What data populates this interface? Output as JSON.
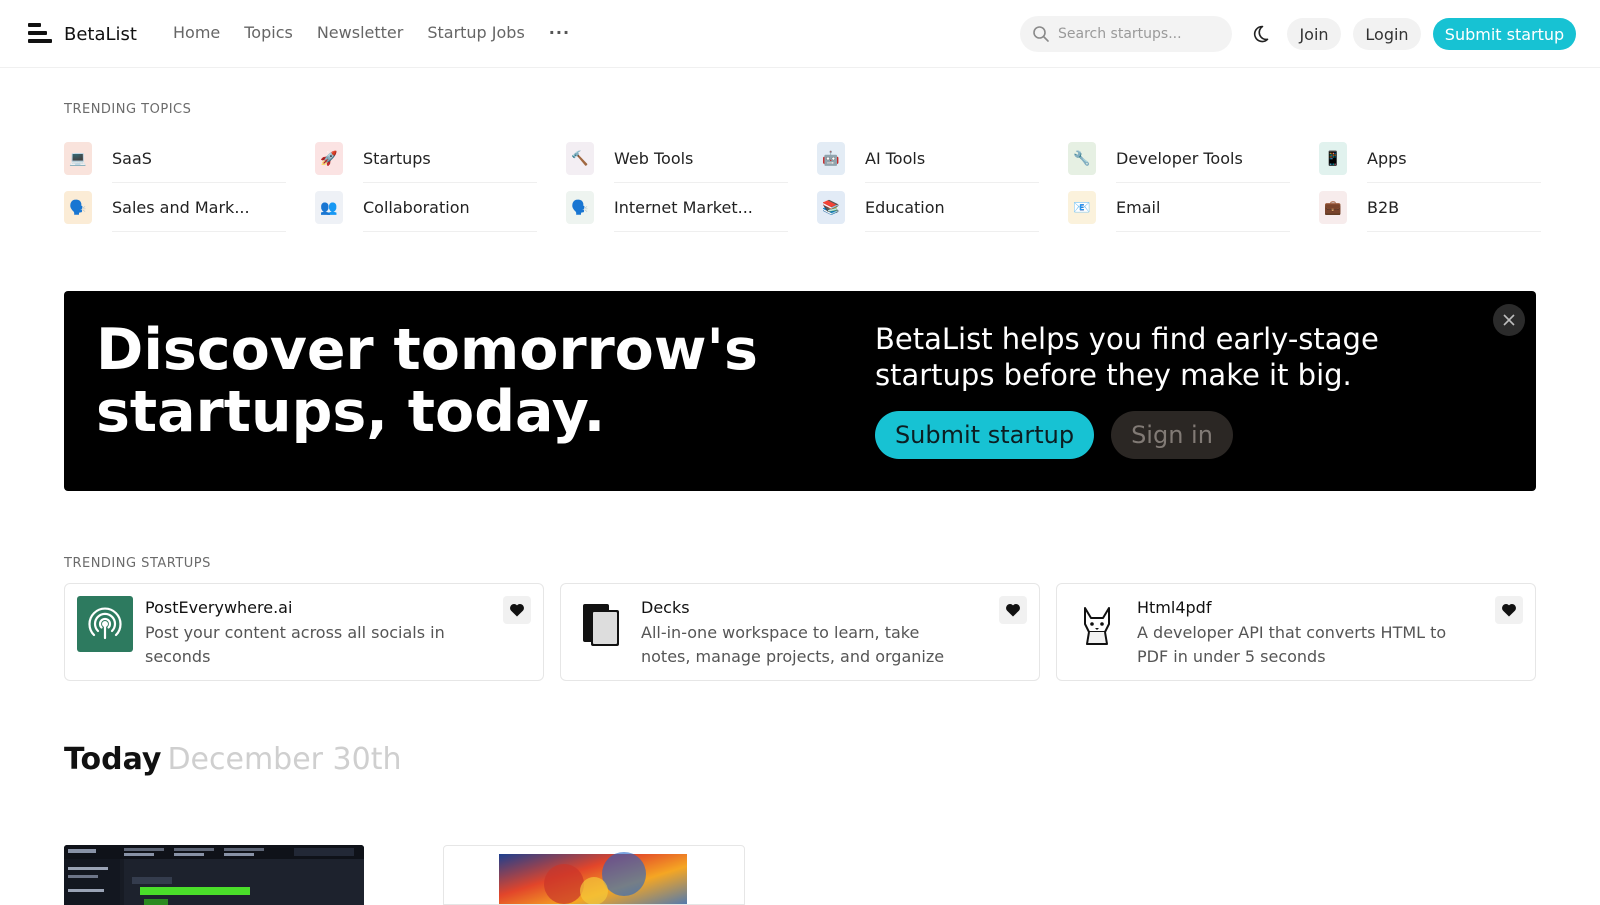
{
  "header": {
    "brand": "BetaList",
    "nav": [
      "Home",
      "Topics",
      "Newsletter",
      "Startup Jobs",
      "···"
    ],
    "search_placeholder": "Search startups...",
    "join_label": "Join",
    "login_label": "Login",
    "submit_label": "Submit startup"
  },
  "trending_topics": {
    "label": "TRENDING TOPICS",
    "items": [
      {
        "label": "SaaS",
        "icon": "laptop-icon",
        "emoji": "💻",
        "bg": "#f9e3dc"
      },
      {
        "label": "Startups",
        "icon": "rocket-icon",
        "emoji": "🚀",
        "bg": "#fbe3e3"
      },
      {
        "label": "Web Tools",
        "icon": "hammer-icon",
        "emoji": "🔨",
        "bg": "#f3eef3"
      },
      {
        "label": "AI Tools",
        "icon": "robot-icon",
        "emoji": "🤖",
        "bg": "#e3ecf5"
      },
      {
        "label": "Developer Tools",
        "icon": "wrench-icon",
        "emoji": "🔧",
        "bg": "#e6f0e3"
      },
      {
        "label": "Apps",
        "icon": "phone-icon",
        "emoji": "📱",
        "bg": "#e1f2ee"
      },
      {
        "label": "Sales and Mark...",
        "icon": "speaking-head-icon",
        "emoji": "🗣️",
        "bg": "#fbecd6"
      },
      {
        "label": "Collaboration",
        "icon": "people-icon",
        "emoji": "👥",
        "bg": "#eef1f6"
      },
      {
        "label": "Internet Market...",
        "icon": "speaking-head-icon",
        "emoji": "🗣️",
        "bg": "#eef4f0"
      },
      {
        "label": "Education",
        "icon": "books-icon",
        "emoji": "📚",
        "bg": "#e2ebf6"
      },
      {
        "label": "Email",
        "icon": "envelope-icon",
        "emoji": "📧",
        "bg": "#fbf2dc"
      },
      {
        "label": "B2B",
        "icon": "briefcase-icon",
        "emoji": "💼",
        "bg": "#f7ecec"
      }
    ]
  },
  "hero": {
    "title": "Discover tomorrow's startups, today.",
    "subtitle": "BetaList helps you find early-stage startups before they make it big.",
    "submit_label": "Submit startup",
    "signin_label": "Sign in"
  },
  "trending_startups": {
    "label": "TRENDING STARTUPS",
    "items": [
      {
        "name": "PostEverywhere.ai",
        "description": "Post your content across all socials in seconds",
        "logo": "broadcast-icon"
      },
      {
        "name": "Decks",
        "description": "All-in-one workspace to learn, take notes, manage projects, and organize",
        "logo": "decks-logo-icon"
      },
      {
        "name": "Html4pdf",
        "description": "A developer API that converts HTML to PDF in under 5 seconds",
        "logo": "fox-icon"
      }
    ]
  },
  "today": {
    "label": "Today",
    "date": "December 30th"
  },
  "colors": {
    "accent": "#17c2d3",
    "hero_bg": "#000000",
    "signin_bg": "#2b2724"
  }
}
